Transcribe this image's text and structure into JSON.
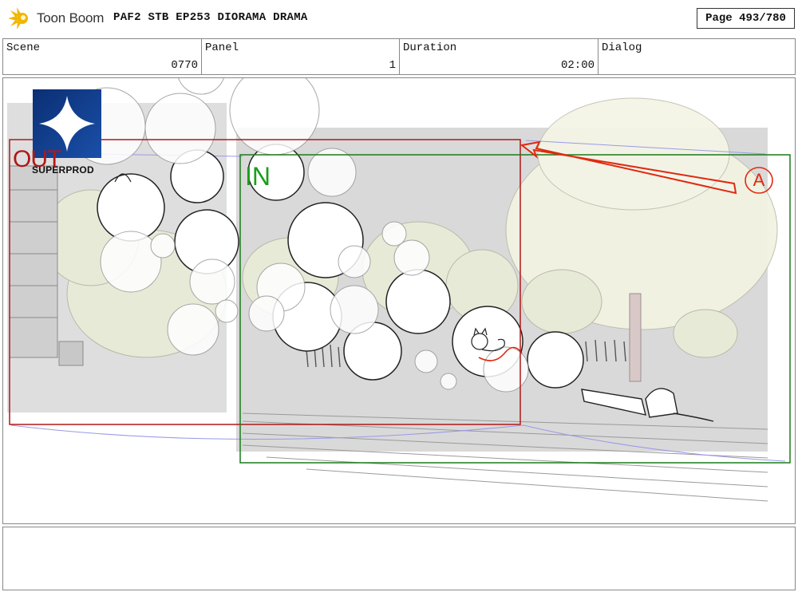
{
  "header": {
    "logo_text": "Toon Boom",
    "document_title": "PAF2 STB EP253 DIORAMA DRAMA",
    "page_indicator": "Page 493/780"
  },
  "info": {
    "scene_label": "Scene",
    "scene_value": "0770",
    "panel_label": "Panel",
    "panel_value": "1",
    "duration_label": "Duration",
    "duration_value": "02:00",
    "dialog_label": "Dialog"
  },
  "panel_art": {
    "out_label": "OUT",
    "in_label": "IN",
    "studio_watermark": "SUPERPROD",
    "annotation_marker": "A",
    "colors": {
      "out_frame": "#b01818",
      "in_frame": "#1a7a1a",
      "annotation": "#e02a10",
      "camera_path": "#8a8ae0",
      "background_gray": "#d8d8d8"
    },
    "icons": [
      "toon-boom-logo-icon",
      "superprod-star-icon",
      "camera-move-arrow-icon"
    ]
  }
}
